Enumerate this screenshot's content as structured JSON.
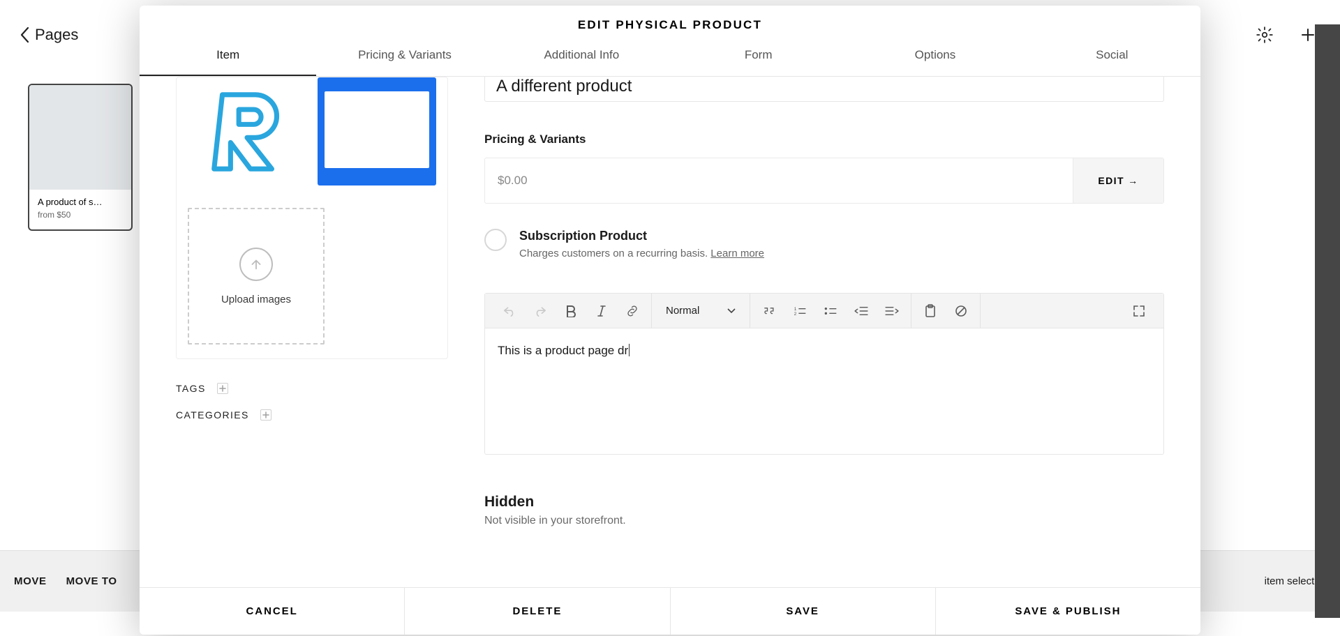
{
  "background": {
    "back_label": "Pages",
    "product_card": {
      "title": "A product of s…",
      "price": "from $50"
    },
    "bottom_actions": {
      "move": "MOVE",
      "move_to": "MOVE TO",
      "selected": "item selected"
    }
  },
  "modal": {
    "title": "EDIT PHYSICAL PRODUCT",
    "tabs": [
      "Item",
      "Pricing & Variants",
      "Additional Info",
      "Form",
      "Options",
      "Social"
    ],
    "product_name": "A different product",
    "upload_label": "Upload images",
    "tags_label": "TAGS",
    "categories_label": "CATEGORIES",
    "pricing": {
      "section_title": "Pricing & Variants",
      "price_value": "$0.00",
      "edit_label": "EDIT →"
    },
    "subscription": {
      "title": "Subscription Product",
      "desc_prefix": "Charges customers on a recurring basis. ",
      "learn_more": "Learn more"
    },
    "editor": {
      "style_select": "Normal",
      "content": "This is a product page dr"
    },
    "hidden": {
      "title": "Hidden",
      "desc": "Not visible in your storefront."
    },
    "footer": {
      "cancel": "CANCEL",
      "delete": "DELETE",
      "save": "SAVE",
      "save_publish": "SAVE & PUBLISH"
    }
  }
}
